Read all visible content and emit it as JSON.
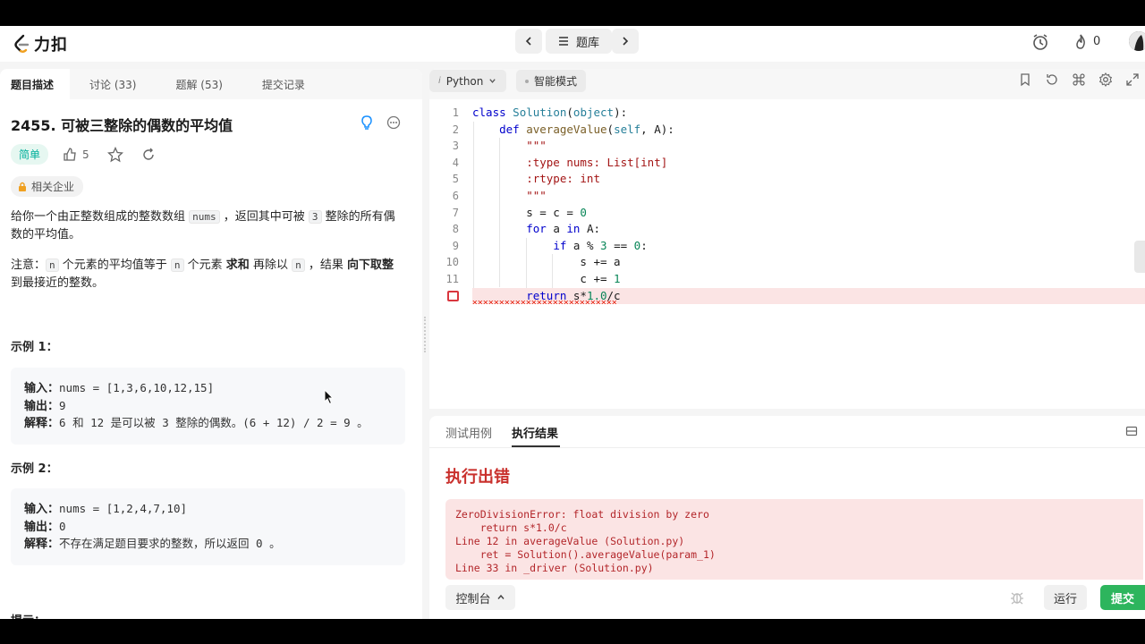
{
  "nav": {
    "logo_text": "力扣",
    "problem_bank": "题库",
    "streak_count": "0"
  },
  "left": {
    "tabs": [
      "题目描述",
      "讨论 (33)",
      "题解 (53)",
      "提交记录"
    ],
    "title": "2455. 可被三整除的偶数的平均值",
    "difficulty": "简单",
    "likes": "5",
    "company_tag": "相关企业",
    "desc1_a": "给你一个由正整数组成的整数数组 ",
    "desc1_code1": "nums",
    "desc1_b": " ，返回其中可被 ",
    "desc1_code2": "3",
    "desc1_c": " 整除的所有偶数的平均值。",
    "desc2_a": "注意：",
    "desc2_code1": "n",
    "desc2_b": " 个元素的平均值等于 ",
    "desc2_code2": "n",
    "desc2_c": " 个元素 ",
    "desc2_bold1": "求和",
    "desc2_d": " 再除以 ",
    "desc2_code3": "n",
    "desc2_e": " ，结果 ",
    "desc2_bold2": "向下取整",
    "desc2_f": " 到最接近的整数。",
    "example1": {
      "title": "示例 1：",
      "input_label": "输入：",
      "input": "nums = [1,3,6,10,12,15]",
      "output_label": "输出：",
      "output": "9",
      "explain_label": "解释：",
      "explain": "6 和 12 是可以被 3 整除的偶数。(6 + 12) / 2 = 9 。"
    },
    "example2": {
      "title": "示例 2：",
      "input_label": "输入：",
      "input": "nums = [1,2,4,7,10]",
      "output_label": "输出：",
      "output": "0",
      "explain_label": "解释：",
      "explain": "不存在满足题目要求的整数，所以返回 0 。"
    },
    "hint_title": "提示："
  },
  "editor": {
    "language": "Python",
    "mode": "智能模式",
    "line_numbers": [
      "1",
      "2",
      "3",
      "4",
      "5",
      "6",
      "7",
      "8",
      "9",
      "10",
      "11"
    ]
  },
  "console": {
    "tab_testcase": "测试用例",
    "tab_result": "执行结果",
    "error_title": "执行出错",
    "error_lines": [
      "ZeroDivisionError: float division by zero",
      "    return s*1.0/c",
      "Line 12 in averageValue (Solution.py)",
      "    ret = Solution().averageValue(param_1)",
      "Line 33 in _driver (Solution.py)"
    ],
    "console_label": "控制台",
    "run_label": "运行",
    "submit_label": "提交"
  },
  "colors": {
    "easy": "#00af9b",
    "error": "#c9302c",
    "submit": "#2db55d"
  }
}
